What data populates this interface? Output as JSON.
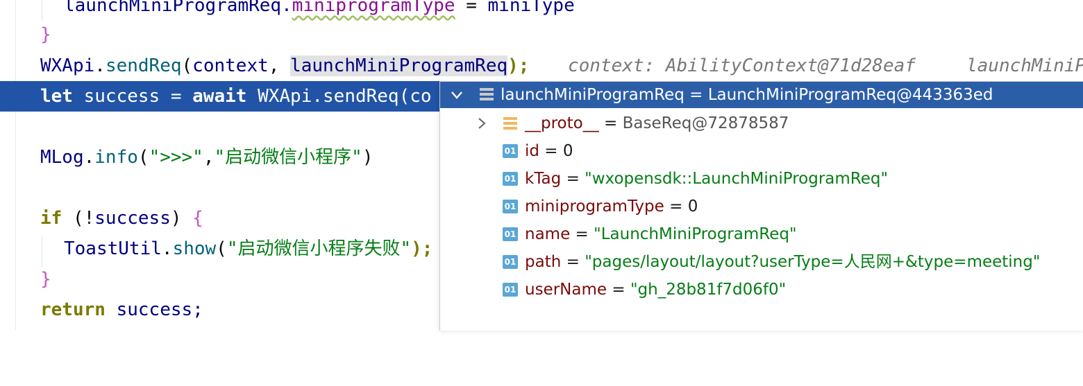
{
  "code": {
    "line0": {
      "prefix": "launchMiniProgramReq.",
      "field": "miniprogramType",
      "eq": " = ",
      "value": "miniType"
    },
    "line1": {
      "brace": "}"
    },
    "line2": {
      "cls": "WXApi",
      "dot": ".",
      "fn": "sendReq",
      "open": "(",
      "arg1": "context",
      "comma": ", ",
      "arg2": "launchMiniProgramReq",
      "close": ");",
      "hint1": "context: AbilityContext@71d28eaf",
      "hint2": "launchMiniP"
    },
    "line3": {
      "let": "let",
      "rest1": " success = ",
      "await": "await",
      "rest2": " WXApi.sendReq(co"
    },
    "line5": {
      "cls": "MLog",
      "dot": ".",
      "fn": "info",
      "open": "(",
      "s1": "\">>>\"",
      "comma": ",",
      "s2": "\"启动微信小程序\"",
      "close": ")"
    },
    "line7": {
      "if": "if",
      "open": " (!",
      "var": "success",
      "close": ") ",
      "brace": "{"
    },
    "line8": {
      "cls": "ToastUtil",
      "dot": ".",
      "fn": "show",
      "open": "(",
      "s1": "\"启动微信小程序失败\"",
      "close": ");"
    },
    "line9": {
      "brace": "}"
    },
    "line10": {
      "ret": "return",
      "rest": " success;"
    }
  },
  "debug_popup": {
    "header": {
      "name": "launchMiniProgramReq",
      "eq": " = ",
      "value": "LaunchMiniProgramReq@443363ed"
    },
    "items": [
      {
        "icon": "object-icon",
        "name": "__proto__",
        "eq": " = ",
        "value": "BaseReq@72878587",
        "type": "obj"
      },
      {
        "icon": "field-01-icon",
        "badge": "01",
        "name": "id",
        "eq": " = ",
        "value": "0",
        "type": "num"
      },
      {
        "icon": "field-01-icon",
        "badge": "01",
        "name": "kTag",
        "eq": " = ",
        "value": "\"wxopensdk::LaunchMiniProgramReq\"",
        "type": "str"
      },
      {
        "icon": "field-01-icon",
        "badge": "01",
        "name": "miniprogramType",
        "eq": " = ",
        "value": "0",
        "type": "num"
      },
      {
        "icon": "field-01-icon",
        "badge": "01",
        "name": "name",
        "eq": " = ",
        "value": "\"LaunchMiniProgramReq\"",
        "type": "str"
      },
      {
        "icon": "field-01-icon",
        "badge": "01",
        "name": "path",
        "eq": " = ",
        "value": "\"pages/layout/layout?userType=人民网+&type=meeting\"",
        "type": "str"
      },
      {
        "icon": "field-01-icon",
        "badge": "01",
        "name": "userName",
        "eq": " = ",
        "value": "\"gh_28b81f7d06f0\"",
        "type": "str"
      }
    ]
  },
  "colors": {
    "exec_line": "#2154a6",
    "popup_header": "#2c5ea8",
    "string": "#067d17",
    "keyword": "#7a7a00"
  }
}
